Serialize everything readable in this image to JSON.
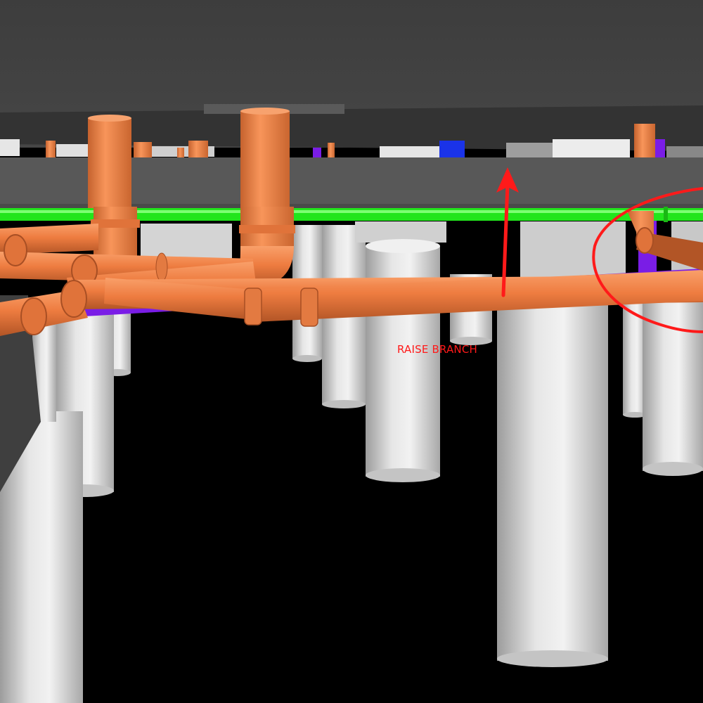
{
  "scene": {
    "markup": {
      "note_text": "RAISE BRANCH",
      "markup_color": "#ff1a1a"
    },
    "colors": {
      "sanitary_pipe": "#ef7f45",
      "sanitary_pipe_dark": "#b85a2a",
      "green_pipe": "#22e51c",
      "purple_pipe": "#7a1de6",
      "blue_element": "#1a33e8",
      "column": "#d8d8d8",
      "slab": "#4b4b4b",
      "beam": "#5e5e5e",
      "background": "#000000"
    }
  }
}
